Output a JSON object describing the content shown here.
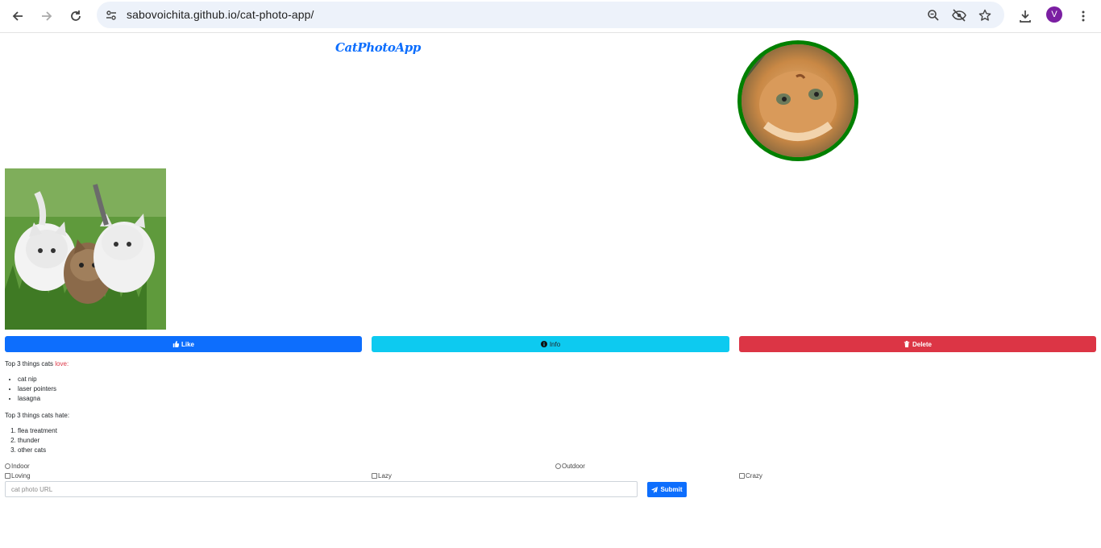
{
  "browser": {
    "url": "sabovoichita.github.io/cat-photo-app/",
    "profile_initial": "V",
    "accent": "#7b1fa2"
  },
  "page": {
    "brand": "CatPhotoApp",
    "buttons": {
      "like": "Like",
      "info": "Info",
      "delete": "Delete"
    },
    "love_prefix": "Top 3 things cats ",
    "love_word": "love:",
    "love_list": [
      "cat nip",
      "laser pointers",
      "lasagna"
    ],
    "hate_heading": "Top 3 things cats hate:",
    "hate_list": [
      "flea treatment",
      "thunder",
      "other cats"
    ],
    "radios": [
      "Indoor",
      "Outdoor"
    ],
    "checkboxes": [
      "Loving",
      "Lazy",
      "Crazy"
    ],
    "url_placeholder": "cat photo URL",
    "submit": "Submit"
  },
  "colors": {
    "primary": "#0d6efd",
    "info": "#0dcaf0",
    "danger": "#dc3545",
    "avatar_border": "#008000"
  },
  "icons": [
    "back-icon",
    "forward-icon",
    "reload-icon",
    "site-info-icon",
    "zoom-icon",
    "eye-off-icon",
    "star-icon",
    "download-icon",
    "more-icon",
    "thumbs-up-icon",
    "info-circle-icon",
    "trash-icon",
    "paper-plane-icon"
  ]
}
